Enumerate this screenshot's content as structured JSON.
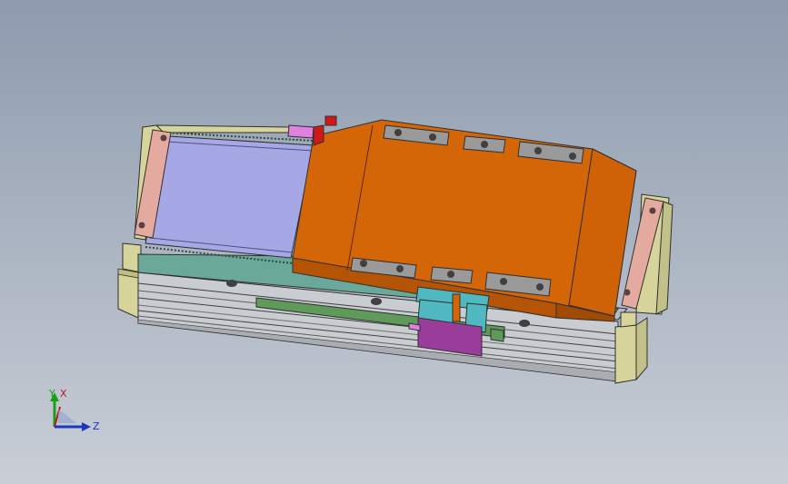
{
  "viewport": {
    "background_top": "#8e9bae",
    "background_bottom": "#c9ced6"
  },
  "model": {
    "colors": {
      "carriage_orange": "#d46608",
      "carriage_orange_dark": "#b45404",
      "cover_lavender": "#a6a8e6",
      "end_plate_pink": "#e4aaa0",
      "end_block_yellow": "#d6d49a",
      "base_gray": "#c9ccd0",
      "rail_green": "#5f9a5a",
      "teal_plate": "#6aa89a",
      "sensor_cyan": "#4fb8c0",
      "sensor_purple": "#9a3d9a",
      "magenta_block": "#e080e0",
      "red_block": "#d01818",
      "screw_gray": "#9a9a9a"
    }
  },
  "triad": {
    "y_label": "Y",
    "x_label": "X",
    "z_label": "Z",
    "y_color": "#18a018",
    "x_color": "#c01818",
    "z_color": "#1838c0"
  }
}
